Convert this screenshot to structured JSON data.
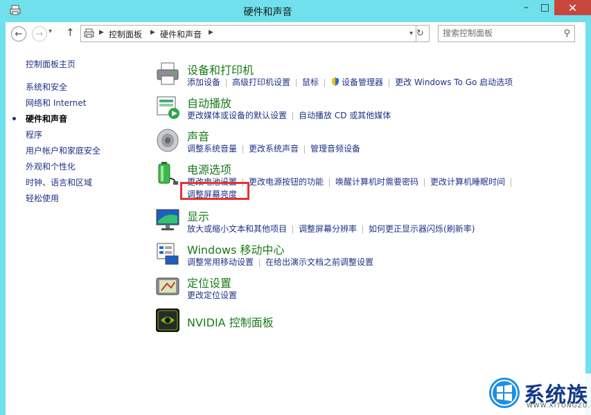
{
  "window": {
    "title": "硬件和声音",
    "minimize_glyph": "–",
    "maximize_glyph": "□",
    "close_glyph": "✕"
  },
  "nav": {
    "back_glyph": "←",
    "forward_glyph": "→",
    "up_glyph": "↑",
    "breadcrumbs": [
      "控制面板",
      "硬件和声音"
    ],
    "refresh_glyph": "↻"
  },
  "search": {
    "placeholder": "搜索控制面板"
  },
  "sidebar": {
    "items": [
      {
        "label": "控制面板主页"
      },
      {
        "label": "系统和安全"
      },
      {
        "label": "网络和 Internet"
      },
      {
        "label": "硬件和声音",
        "active": true
      },
      {
        "label": "程序"
      },
      {
        "label": "用户帐户和家庭安全"
      },
      {
        "label": "外观和个性化"
      },
      {
        "label": "时钟、语言和区域"
      },
      {
        "label": "轻松使用"
      }
    ]
  },
  "categories": [
    {
      "title": "设备和打印机",
      "icon": "printer-icon",
      "links": [
        "添加设备",
        "高级打印机设置",
        "鼠标",
        "设备管理器",
        "更改 Windows To Go 启动选项"
      ]
    },
    {
      "title": "自动播放",
      "icon": "autoplay-icon",
      "links": [
        "更改媒体或设备的默认设置",
        "自动播放 CD 或其他媒体"
      ]
    },
    {
      "title": "声音",
      "icon": "speaker-icon",
      "links": [
        "调整系统音量",
        "更改系统声音",
        "管理音频设备"
      ]
    },
    {
      "title": "电源选项",
      "icon": "battery-icon",
      "links": [
        "更改电池设置",
        "更改电源按钮的功能",
        "唤醒计算机时需要密码",
        "更改计算机睡眠时间"
      ],
      "links2": [
        "调整屏幕亮度"
      ]
    },
    {
      "title": "显示",
      "icon": "monitor-icon",
      "links": [
        "放大或缩小文本和其他项目",
        "调整屏幕分辨率",
        "如何更正显示器闪烁(刷新率)"
      ]
    },
    {
      "title": "Windows 移动中心",
      "icon": "mobility-center-icon",
      "links": [
        "调整常用移动设置",
        "在给出演示文档之前调整设置"
      ]
    },
    {
      "title": "定位设置",
      "icon": "location-icon",
      "links": [
        "更改定位设置"
      ]
    },
    {
      "title": "NVIDIA 控制面板",
      "icon": "nvidia-icon",
      "links": []
    }
  ],
  "watermark": {
    "text": "系统族",
    "url": "WWW.XITONGZU.COM"
  },
  "colors": {
    "titlebar": "#6fe0ec",
    "link": "#1e3287",
    "category_title": "#1a7a1a",
    "highlight": "#e53232",
    "close": "#c7473c"
  }
}
